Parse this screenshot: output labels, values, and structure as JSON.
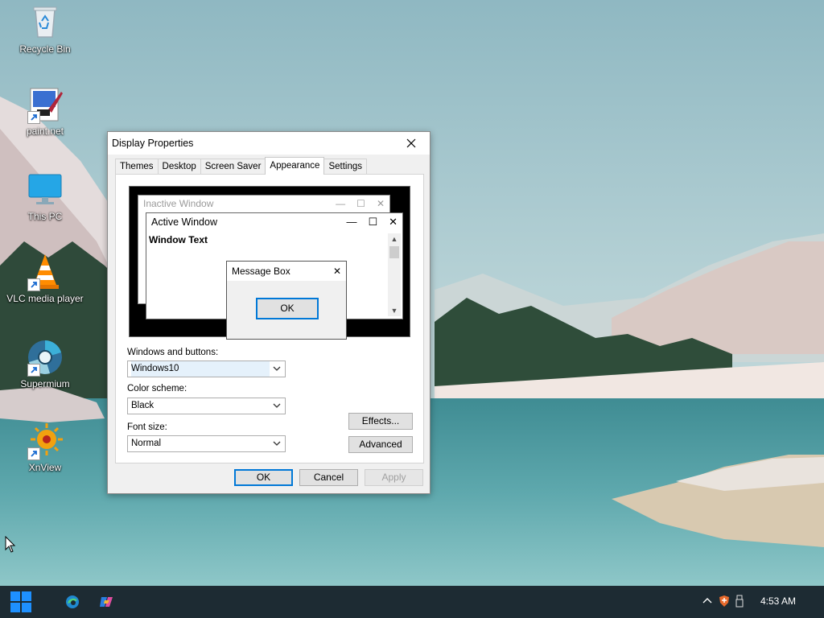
{
  "desktop": {
    "icons": [
      {
        "label": "Recycle Bin",
        "icon": "recycle-bin-icon"
      },
      {
        "label": "paint.net",
        "icon": "paintnet-icon"
      },
      {
        "label": "This PC",
        "icon": "monitor-icon"
      },
      {
        "label": "VLC media player",
        "icon": "vlc-cone-icon"
      },
      {
        "label": "Supermium",
        "icon": "supermium-icon"
      },
      {
        "label": "XnView",
        "icon": "xnview-icon"
      }
    ]
  },
  "dialog": {
    "title": "Display Properties",
    "tabs": [
      "Themes",
      "Desktop",
      "Screen Saver",
      "Appearance",
      "Settings"
    ],
    "active_tab": "Appearance",
    "preview": {
      "inactive_title": "Inactive Window",
      "active_title": "Active Window",
      "window_text": "Window Text",
      "message_box_title": "Message Box",
      "message_box_ok": "OK"
    },
    "windows_and_buttons": {
      "label": "Windows and buttons:",
      "value": "Windows10"
    },
    "color_scheme": {
      "label": "Color scheme:",
      "value": "Black"
    },
    "font_size": {
      "label": "Font size:",
      "value": "Normal"
    },
    "effects_label": "Effects...",
    "advanced_label": "Advanced",
    "ok_label": "OK",
    "cancel_label": "Cancel",
    "apply_label": "Apply"
  },
  "taskbar": {
    "clock": "4:53 AM",
    "accent": "#0078d7"
  }
}
